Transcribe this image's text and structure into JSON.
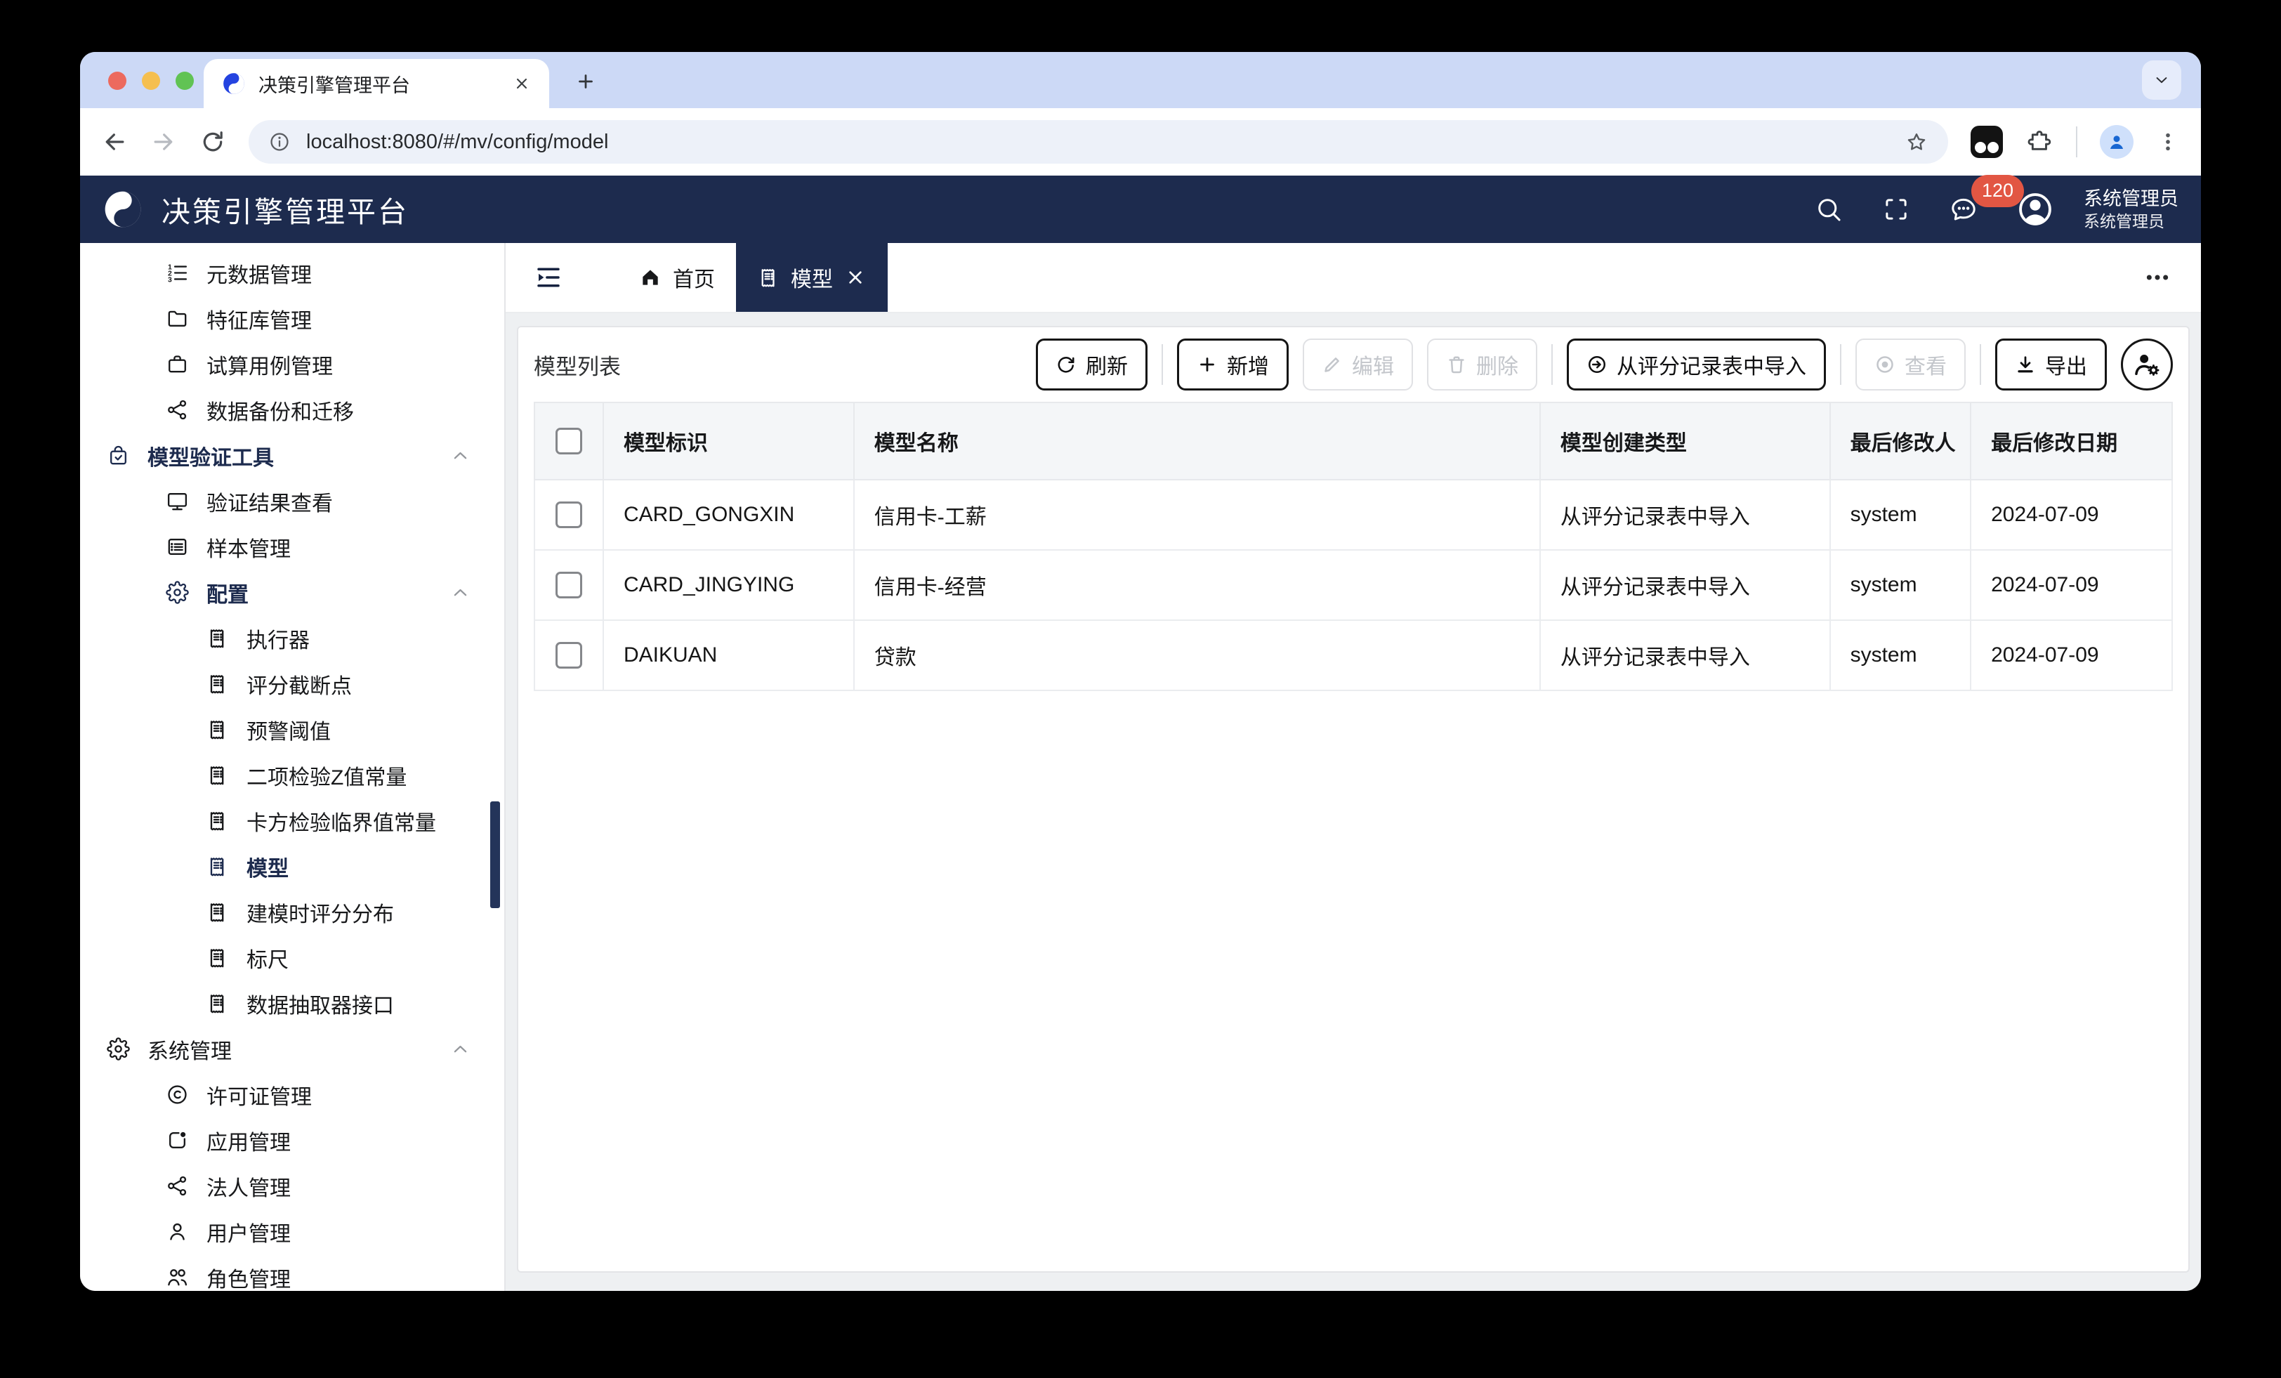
{
  "colors": {
    "navy": "#1d2b4e",
    "badge_red": "#e25643",
    "tabstrip_blue": "#ccd9f6",
    "favicon_blue": "#2443e0",
    "disabled_gray": "#c3c6cb"
  },
  "browser": {
    "tab_title": "决策引擎管理平台",
    "url": "localhost:8080/#/mv/config/model"
  },
  "navbar": {
    "title": "决策引擎管理平台",
    "badge_count": "120",
    "user_name": "系统管理员",
    "user_role": "系统管理员"
  },
  "sidebar": {
    "items": [
      {
        "label": "元数据管理",
        "level": 2
      },
      {
        "label": "特征库管理",
        "level": 2
      },
      {
        "label": "试算用例管理",
        "level": 2
      },
      {
        "label": "数据备份和迁移",
        "level": 2
      },
      {
        "label": "模型验证工具",
        "level": 1,
        "expanded": true,
        "active": true
      },
      {
        "label": "验证结果查看",
        "level": 2
      },
      {
        "label": "样本管理",
        "level": 2
      },
      {
        "label": "配置",
        "level": 2,
        "expanded": true,
        "active": true
      },
      {
        "label": "执行器",
        "level": 3
      },
      {
        "label": "评分截断点",
        "level": 3
      },
      {
        "label": "预警阈值",
        "level": 3
      },
      {
        "label": "二项检验Z值常量",
        "level": 3
      },
      {
        "label": "卡方检验临界值常量",
        "level": 3
      },
      {
        "label": "模型",
        "level": 3,
        "selected": true
      },
      {
        "label": "建模时评分分布",
        "level": 3
      },
      {
        "label": "标尺",
        "level": 3
      },
      {
        "label": "数据抽取器接口",
        "level": 3
      },
      {
        "label": "系统管理",
        "level": 1,
        "expanded": true
      },
      {
        "label": "许可证管理",
        "level": 2
      },
      {
        "label": "应用管理",
        "level": 2
      },
      {
        "label": "法人管理",
        "level": 2
      },
      {
        "label": "用户管理",
        "level": 2
      },
      {
        "label": "角色管理",
        "level": 2
      }
    ]
  },
  "tabs": {
    "home": "首页",
    "active": "模型"
  },
  "page": {
    "title": "模型列表",
    "buttons": {
      "refresh": "刷新",
      "add": "新增",
      "edit": "编辑",
      "delete": "删除",
      "import": "从评分记录表中导入",
      "view": "查看",
      "export": "导出"
    },
    "table": {
      "headers": [
        "模型标识",
        "模型名称",
        "模型创建类型",
        "最后修改人",
        "最后修改日期"
      ],
      "rows": [
        {
          "model_id": "CARD_GONGXIN",
          "model_name": "信用卡-工薪",
          "create_type": "从评分记录表中导入",
          "modified_by": "system",
          "modified_date": "2024-07-09"
        },
        {
          "model_id": "CARD_JINGYING",
          "model_name": "信用卡-经营",
          "create_type": "从评分记录表中导入",
          "modified_by": "system",
          "modified_date": "2024-07-09"
        },
        {
          "model_id": "DAIKUAN",
          "model_name": "贷款",
          "create_type": "从评分记录表中导入",
          "modified_by": "system",
          "modified_date": "2024-07-09"
        }
      ]
    }
  },
  "icons": [
    "swirl-logo",
    "search-icon",
    "fullscreen-icon",
    "chat-icon",
    "avatar-icon",
    "ordered-list-icon",
    "folder-icon",
    "briefcase-icon",
    "share-icon",
    "bag-check-icon",
    "monitor-icon",
    "list-box-icon",
    "gear-icon",
    "receipt-icon",
    "copyright-icon",
    "app-icon",
    "user-icon",
    "users-icon",
    "chevron-up-icon",
    "collapse-icon",
    "home-icon",
    "close-icon",
    "more-icon",
    "refresh-icon",
    "plus-icon",
    "pencil-icon",
    "trash-icon",
    "import-icon",
    "view-icon",
    "download-icon",
    "person-gear-icon"
  ]
}
